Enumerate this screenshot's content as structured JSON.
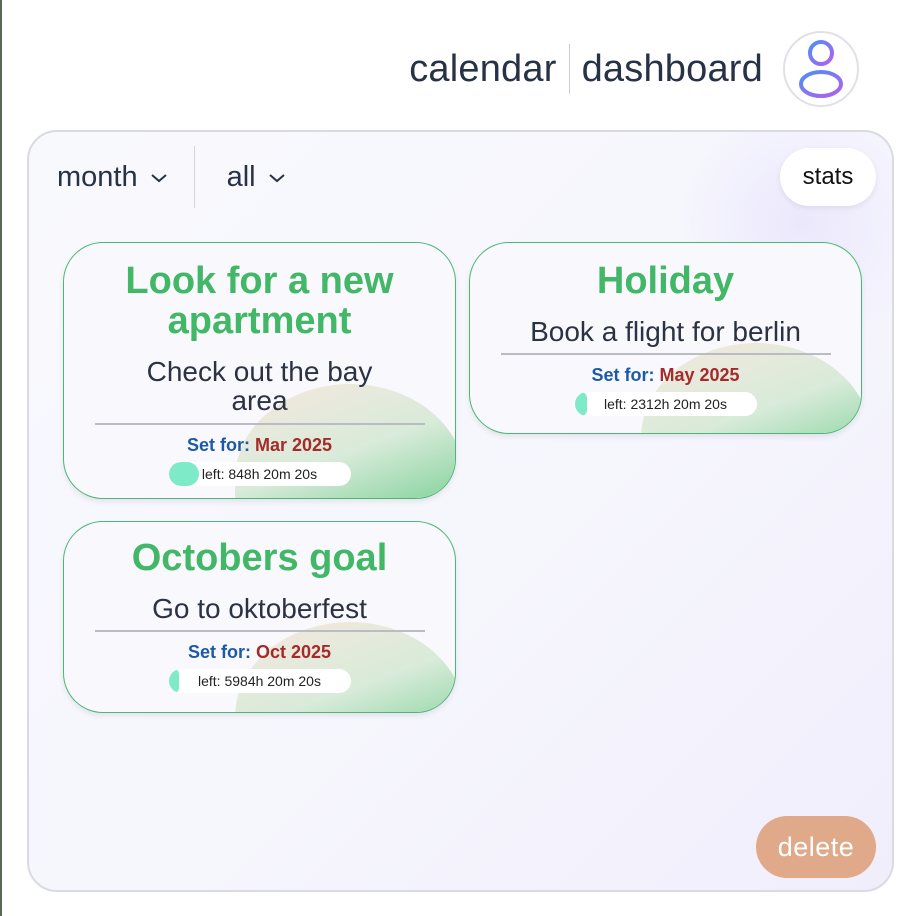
{
  "header": {
    "calendar_label": "calendar",
    "dashboard_label": "dashboard",
    "avatar_icon": "user-icon"
  },
  "filters": {
    "period": {
      "value": "month",
      "icon": "chevron-down-icon"
    },
    "category": {
      "value": "all",
      "icon": "chevron-down-icon"
    }
  },
  "buttons": {
    "stats_label": "stats",
    "delete_label": "delete"
  },
  "colors": {
    "title_green": "#41b767",
    "setfor_blue": "#1c5aa8",
    "date_red": "#a52a2a",
    "progress_mint": "#7eeac8",
    "delete_orange": "#e0a98a"
  },
  "goals": [
    {
      "title": "Look for a new apartment",
      "description": "Check out the bay area",
      "set_for_label": "Set for:",
      "set_for_value": "Mar 2025",
      "time_left": "left: 848h 20m 20s",
      "progress": 0.17
    },
    {
      "title": "Holiday",
      "description": "Book a flight for berlin",
      "set_for_label": "Set for:",
      "set_for_value": "May 2025",
      "time_left": "left: 2312h 20m 20s",
      "progress": 0.07
    },
    {
      "title": "Octobers goal",
      "description": "Go to oktoberfest",
      "set_for_label": "Set for:",
      "set_for_value": "Oct 2025",
      "time_left": "left: 5984h 20m 20s",
      "progress": 0.03
    }
  ]
}
